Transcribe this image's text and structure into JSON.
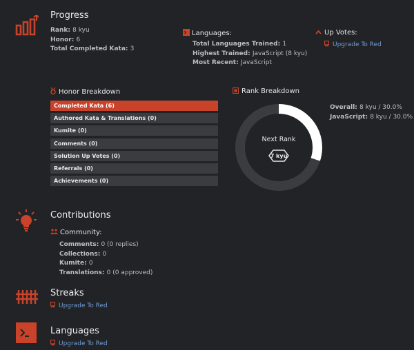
{
  "progress": {
    "title": "Progress",
    "rank_label": "Rank:",
    "rank_value": "8 kyu",
    "honor_label": "Honor:",
    "honor_value": "6",
    "completed_label": "Total Completed Kata:",
    "completed_value": "3"
  },
  "languages_summary": {
    "title": "Languages:",
    "trained_label": "Total Languages Trained:",
    "trained_value": "1",
    "highest_label": "Highest Trained:",
    "highest_value": "JavaScript (8 kyu)",
    "recent_label": "Most Recent:",
    "recent_value": "JavaScript"
  },
  "upvotes": {
    "title": "Up Votes:",
    "upgrade_link": "Upgrade To Red"
  },
  "honor_breakdown": {
    "title": "Honor Breakdown",
    "items": [
      {
        "label": "Completed Kata (6)",
        "active": true
      },
      {
        "label": "Authored Kata & Translations (0)",
        "active": false
      },
      {
        "label": "Kumite (0)",
        "active": false
      },
      {
        "label": "Comments (0)",
        "active": false
      },
      {
        "label": "Solution Up Votes (0)",
        "active": false
      },
      {
        "label": "Referrals (0)",
        "active": false
      },
      {
        "label": "Achievements (0)",
        "active": false
      }
    ]
  },
  "rank_breakdown": {
    "title": "Rank Breakdown",
    "next_rank_label": "Next Rank",
    "next_rank_badge": "7 kyu",
    "progress_fraction": 0.3,
    "overall_label": "Overall:",
    "overall_value": "8 kyu / 30.0%",
    "javascript_label": "JavaScript:",
    "javascript_value": "8 kyu / 30.0%"
  },
  "contributions": {
    "title": "Contributions",
    "community_label": "Community:",
    "comments_label": "Comments:",
    "comments_value": "0 (0 replies)",
    "collections_label": "Collections:",
    "collections_value": "0",
    "kumite_label": "Kumite:",
    "kumite_value": "0",
    "translations_label": "Translations:",
    "translations_value": "0 (0 approved)"
  },
  "streaks": {
    "title": "Streaks",
    "upgrade_link": "Upgrade To Red"
  },
  "languages_section": {
    "title": "Languages",
    "upgrade_link": "Upgrade To Red"
  },
  "colors": {
    "accent": "#c9432a",
    "background": "#222326",
    "bar": "#3b3c3f",
    "link": "#6f9dd6"
  }
}
